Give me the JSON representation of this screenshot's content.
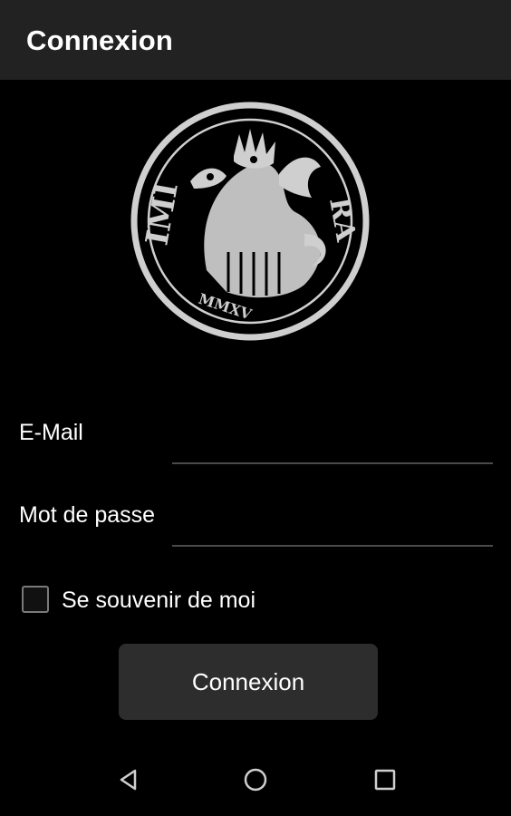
{
  "app_bar": {
    "title": "Connexion"
  },
  "logo": {
    "name": "seal-logo",
    "left_inscription": "IMI",
    "right_inscription": "RA",
    "bottom_inscription": "MMXV"
  },
  "form": {
    "email_label": "E-Mail",
    "email_value": "",
    "password_label": "Mot de passe",
    "password_value": "",
    "remember_label": "Se souvenir de moi",
    "remember_checked": false,
    "submit_label": "Connexion"
  },
  "nav_bar": {
    "back_icon": "back-triangle-icon",
    "home_icon": "home-circle-icon",
    "recents_icon": "recents-square-icon"
  },
  "colors": {
    "background": "#000000",
    "app_bar": "#222222",
    "button": "#2d2d2d",
    "underline": "#4a4a4a",
    "logo_fg": "#cfcfcf"
  }
}
